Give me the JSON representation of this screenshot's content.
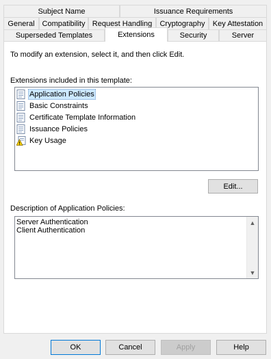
{
  "tabs": {
    "row1": [
      "Subject Name",
      "Issuance Requirements"
    ],
    "row2": [
      "General",
      "Compatibility",
      "Request Handling",
      "Cryptography",
      "Key Attestation"
    ],
    "row3": [
      "Superseded Templates",
      "Extensions",
      "Security",
      "Server"
    ]
  },
  "extensions": {
    "instruction": "To modify an extension, select it, and then click Edit.",
    "list_label": "Extensions included in this template:",
    "items": [
      {
        "label": "Application Policies",
        "icon": "certificate-icon",
        "selected": true
      },
      {
        "label": "Basic Constraints",
        "icon": "certificate-icon",
        "selected": false
      },
      {
        "label": "Certificate Template Information",
        "icon": "certificate-icon",
        "selected": false
      },
      {
        "label": "Issuance Policies",
        "icon": "certificate-icon",
        "selected": false
      },
      {
        "label": "Key Usage",
        "icon": "warning-certificate-icon",
        "selected": false
      }
    ],
    "edit_button": "Edit...",
    "description_label": "Description of Application Policies:",
    "description_lines": [
      "Server Authentication",
      "Client Authentication"
    ]
  },
  "footer": {
    "ok": "OK",
    "cancel": "Cancel",
    "apply": "Apply",
    "help": "Help"
  },
  "colors": {
    "selection": "#cce8ff",
    "accent": "#0078d7"
  }
}
